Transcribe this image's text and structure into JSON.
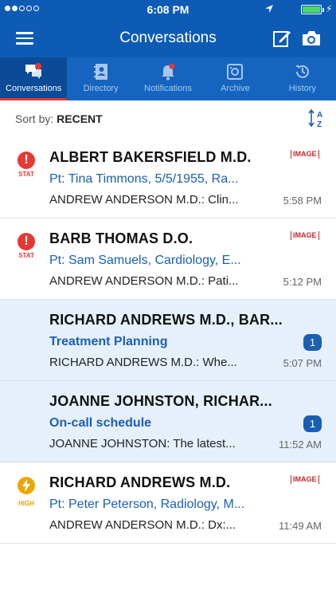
{
  "status_bar": {
    "time": "6:08 PM"
  },
  "nav": {
    "title": "Conversations"
  },
  "tabs": [
    {
      "label": "Conversations",
      "icon": "chat-bubbles-icon",
      "active": true
    },
    {
      "label": "Directory",
      "icon": "address-book-icon",
      "active": false
    },
    {
      "label": "Notifications",
      "icon": "bell-icon",
      "active": false
    },
    {
      "label": "Archive",
      "icon": "archive-box-icon",
      "active": false
    },
    {
      "label": "History",
      "icon": "clock-history-icon",
      "active": false
    }
  ],
  "sort": {
    "prefix": "Sort by:",
    "value": "RECENT"
  },
  "colors": {
    "nav_blue": "#0e5bb5",
    "tab_active": "#0a4a96",
    "accent_red": "#e53935",
    "link_blue": "#1a5fb4",
    "unread_bg": "#e6f0fb"
  },
  "conversations": [
    {
      "priority": "STAT",
      "name": "ALBERT BAKERSFIELD M.D.",
      "subject": "Pt: Tina Timmons, 5/5/1955, Ra...",
      "preview": "ANDREW ANDERSON M.D.: Clin...",
      "time": "5:58 PM",
      "tag": "IMAGE",
      "unread_count": null
    },
    {
      "priority": "STAT",
      "name": "BARB THOMAS D.O.",
      "subject": "Pt: Sam Samuels, Cardiology, E...",
      "preview": "ANDREW ANDERSON M.D.: Pati...",
      "time": "5:12 PM",
      "tag": "IMAGE",
      "unread_count": null
    },
    {
      "priority": "",
      "name": "RICHARD ANDREWS M.D., BAR...",
      "subject": "Treatment Planning",
      "preview": "RICHARD ANDREWS M.D.: Whe...",
      "time": "5:07 PM",
      "tag": "",
      "unread_count": "1"
    },
    {
      "priority": "",
      "name": "JOANNE JOHNSTON, RICHAR...",
      "subject": "On-call schedule",
      "preview": "JOANNE JOHNSTON: The latest...",
      "time": "11:52 AM",
      "tag": "",
      "unread_count": "1"
    },
    {
      "priority": "HIGH",
      "name": "RICHARD ANDREWS M.D.",
      "subject": "Pt: Peter Peterson, Radiology, M...",
      "preview": "ANDREW ANDERSON M.D.: Dx:...",
      "time": "11:49 AM",
      "tag": "IMAGE",
      "unread_count": null
    }
  ]
}
